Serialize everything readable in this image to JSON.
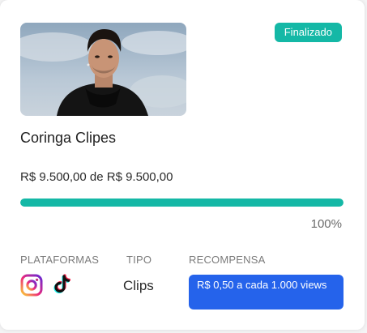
{
  "campaign": {
    "title": "Coringa Clipes",
    "status": "Finalizado",
    "amount_text": "R$ 9.500,00 de R$ 9.500,00",
    "progress_fraction": 1.0,
    "progress_percent_text": "100%",
    "labels": {
      "platforms": "PLATAFORMAS",
      "type": "TIPO",
      "reward": "RECOMPENSA"
    },
    "platforms": [
      "instagram-icon",
      "tiktok-icon"
    ],
    "type_value": "Clips",
    "reward_text": "R$ 0,50 a cada 1.000 views"
  },
  "colors": {
    "status_badge": "#14b8a6",
    "progress_fill": "#14b8a6",
    "reward_box": "#2563eb"
  }
}
